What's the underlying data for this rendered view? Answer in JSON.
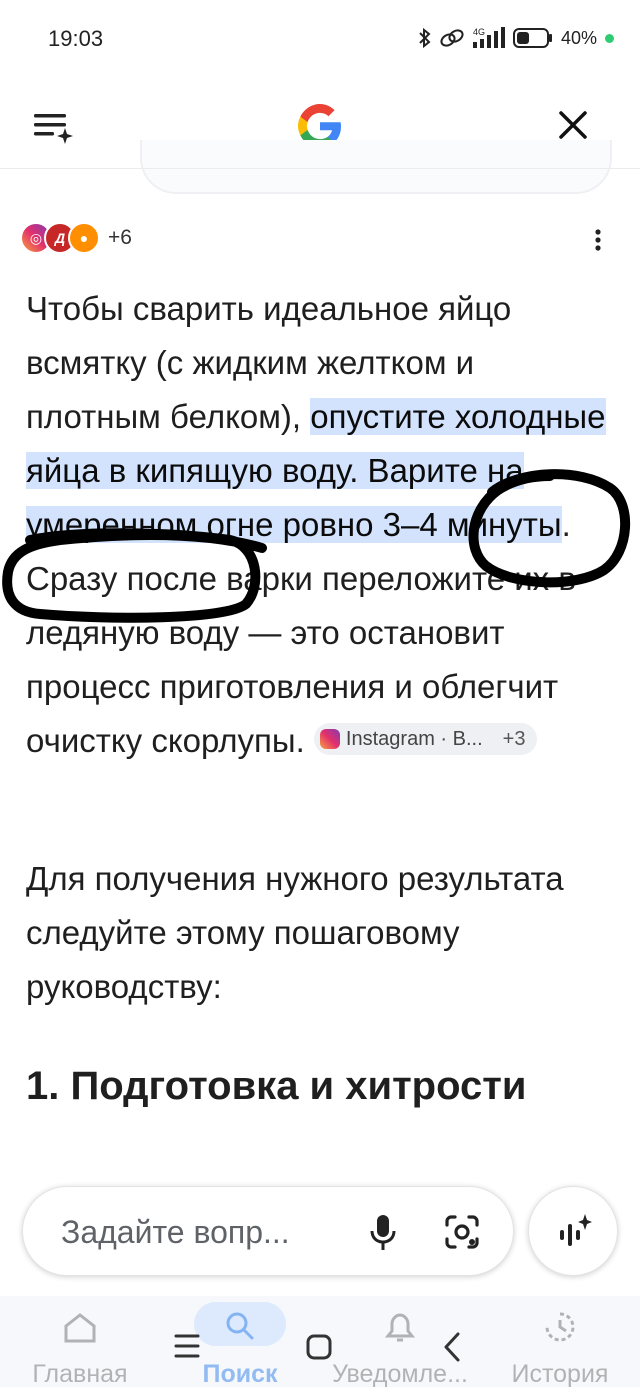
{
  "status_bar": {
    "time": "19:03",
    "network": "4G",
    "battery": "40%",
    "icons": [
      "bluetooth-icon",
      "link-icon",
      "signal-icon",
      "battery-icon"
    ]
  },
  "app_bar": {
    "menu_icon": "menu-sparkle-icon",
    "logo": "google-g-logo",
    "close_icon": "close-icon"
  },
  "sources": {
    "icons": [
      "instagram-icon",
      "source-d-icon",
      "orange-icon"
    ],
    "more_count": "+6"
  },
  "answer": {
    "p1_plain": "Чтобы сварить идеальное яйцо всмятку (с жидким желтком и плотным белком), ",
    "p1_highlight": "опустите холодные яйца в кипящую воду. Варите на умеренном огне ровно 3–4 минуты",
    "p1_rest": ". Сразу после варки переложите их в ледяную воду — это остановит процесс приготовления и облегчит очистку скорлупы.",
    "citation": {
      "label": "Instagram · В...",
      "count": "+3"
    }
  },
  "intro2": "Для получения нужного результата следуйте этому пошаговому руководству:",
  "section_heading": "1. Подготовка и хитрости",
  "ask_bar": {
    "placeholder": "Задайте вопр..."
  },
  "bottom_nav": {
    "items": [
      {
        "label": "Главная",
        "icon": "home-icon"
      },
      {
        "label": "Поиск",
        "icon": "search-icon"
      },
      {
        "label": "Уведомле...",
        "icon": "bell-icon"
      },
      {
        "label": "История",
        "icon": "history-icon"
      }
    ]
  },
  "colors": {
    "highlight": "#d3e3fd",
    "accent": "#1a73e8"
  }
}
